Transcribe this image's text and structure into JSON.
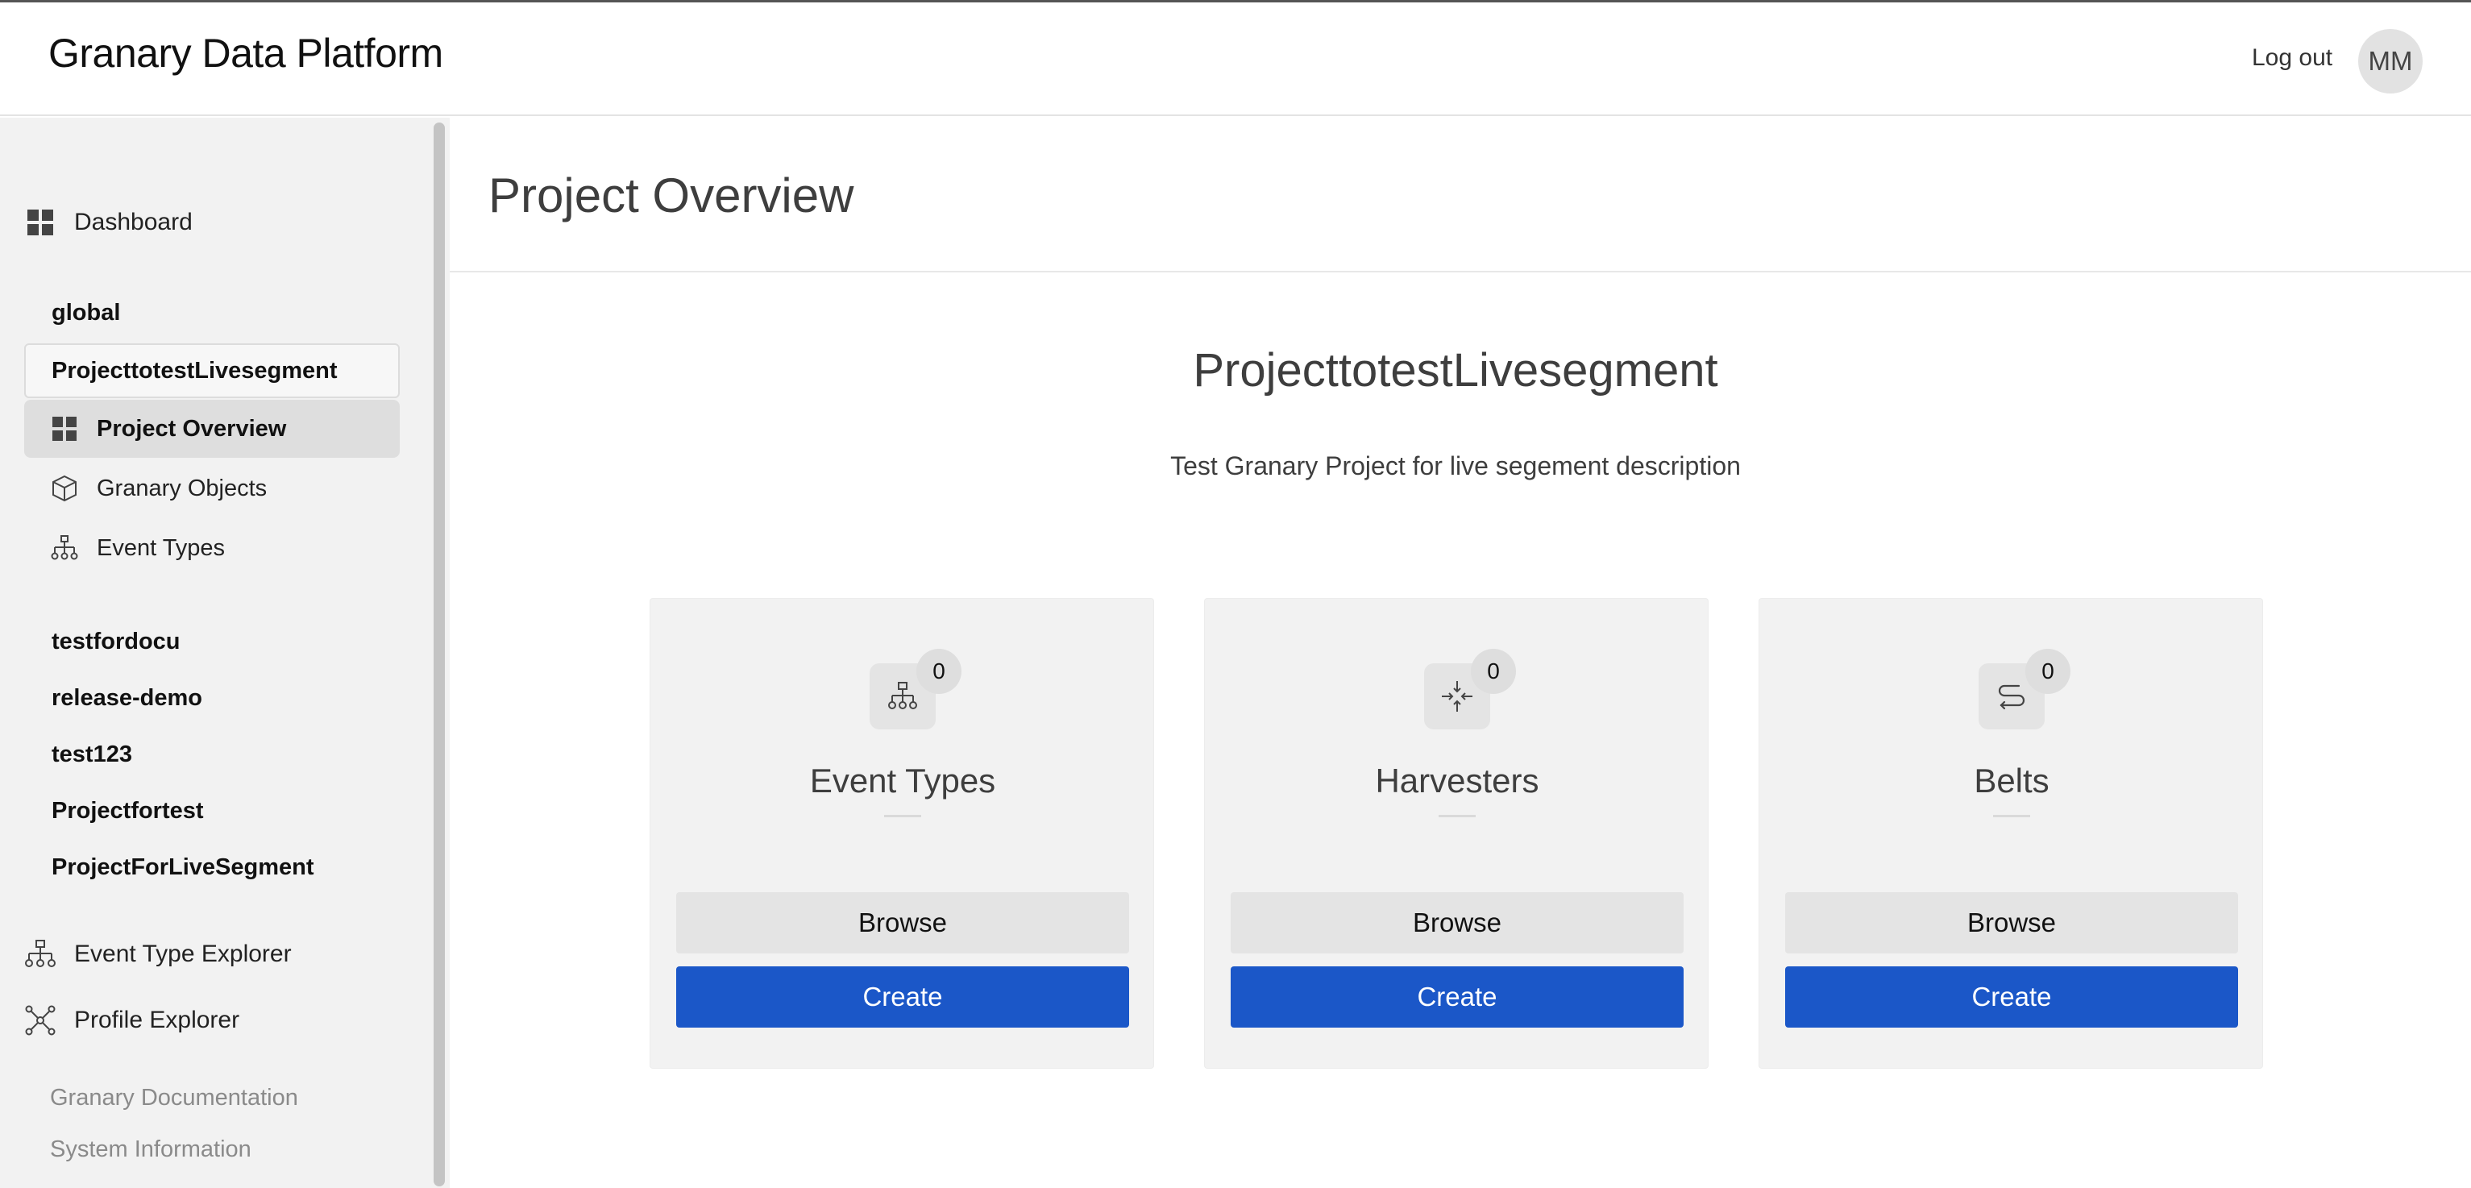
{
  "header": {
    "app_title": "Granary Data Platform",
    "logout_label": "Log out",
    "avatar_initials": "MM"
  },
  "sidebar": {
    "dashboard_label": "Dashboard",
    "group_global": "global",
    "selected_project": "ProjecttotestLivesegment",
    "project_items": [
      {
        "label": "Project Overview",
        "icon": "dashboard-grid-icon",
        "active": true
      },
      {
        "label": "Granary Objects",
        "icon": "cube-icon",
        "active": false
      },
      {
        "label": "Event Types",
        "icon": "hierarchy-icon",
        "active": false
      }
    ],
    "other_projects": [
      "testfordocu",
      "release-demo",
      "test123",
      "Projectfortest",
      "ProjectForLiveSegment"
    ],
    "event_type_explorer_label": "Event Type Explorer",
    "profile_explorer_label": "Profile Explorer",
    "footer_links": [
      "Granary Documentation",
      "System Information"
    ]
  },
  "main": {
    "page_title": "Project Overview",
    "project_name": "ProjecttotestLivesegment",
    "project_description": "Test Granary Project for live segement description",
    "cards": [
      {
        "title": "Event Types",
        "count": "0",
        "icon": "hierarchy-icon",
        "browse_label": "Browse",
        "create_label": "Create"
      },
      {
        "title": "Harvesters",
        "count": "0",
        "icon": "compress-arrows-icon",
        "browse_label": "Browse",
        "create_label": "Create"
      },
      {
        "title": "Belts",
        "count": "0",
        "icon": "route-icon",
        "browse_label": "Browse",
        "create_label": "Create"
      }
    ]
  },
  "colors": {
    "primary_button": "#1b57c8",
    "sidebar_bg": "#f2f2f2",
    "active_item_bg": "#dedede"
  }
}
